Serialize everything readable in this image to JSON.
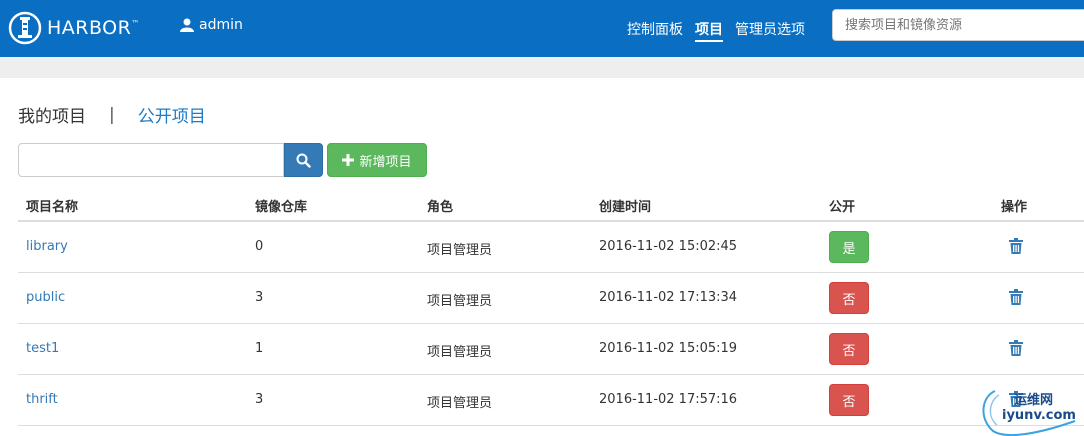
{
  "navbar": {
    "brand": "HARBOR",
    "brand_tm": "™",
    "user": "admin",
    "links": [
      "控制面板",
      "项目",
      "管理员选项"
    ],
    "active_link": "项目",
    "search_placeholder": "搜索项目和镜像资源",
    "bg_color": "#0a6fc2"
  },
  "tabs": {
    "mine": "我的项目",
    "separator": "|",
    "public": "公开项目"
  },
  "toolbar": {
    "filter_value": "",
    "add_label": "新增项目"
  },
  "table": {
    "columns": [
      "项目名称",
      "镜像仓库",
      "角色",
      "创建时间",
      "公开",
      "操作"
    ],
    "rows": [
      {
        "name": "library",
        "repos": "0",
        "role": "项目管理员",
        "created": "2016-11-02 15:02:45",
        "public": "是",
        "is_public": true
      },
      {
        "name": "public",
        "repos": "3",
        "role": "项目管理员",
        "created": "2016-11-02 17:13:34",
        "public": "否",
        "is_public": false
      },
      {
        "name": "test1",
        "repos": "1",
        "role": "项目管理员",
        "created": "2016-11-02 15:05:19",
        "public": "否",
        "is_public": false
      },
      {
        "name": "thrift",
        "repos": "3",
        "role": "项目管理员",
        "created": "2016-11-02 17:57:16",
        "public": "否",
        "is_public": false
      }
    ]
  },
  "watermark": {
    "top": "运维网",
    "bottom": "iyunv.com"
  },
  "colors": {
    "accent": "#337ab7",
    "success": "#5cb85c",
    "danger": "#d9534f"
  }
}
